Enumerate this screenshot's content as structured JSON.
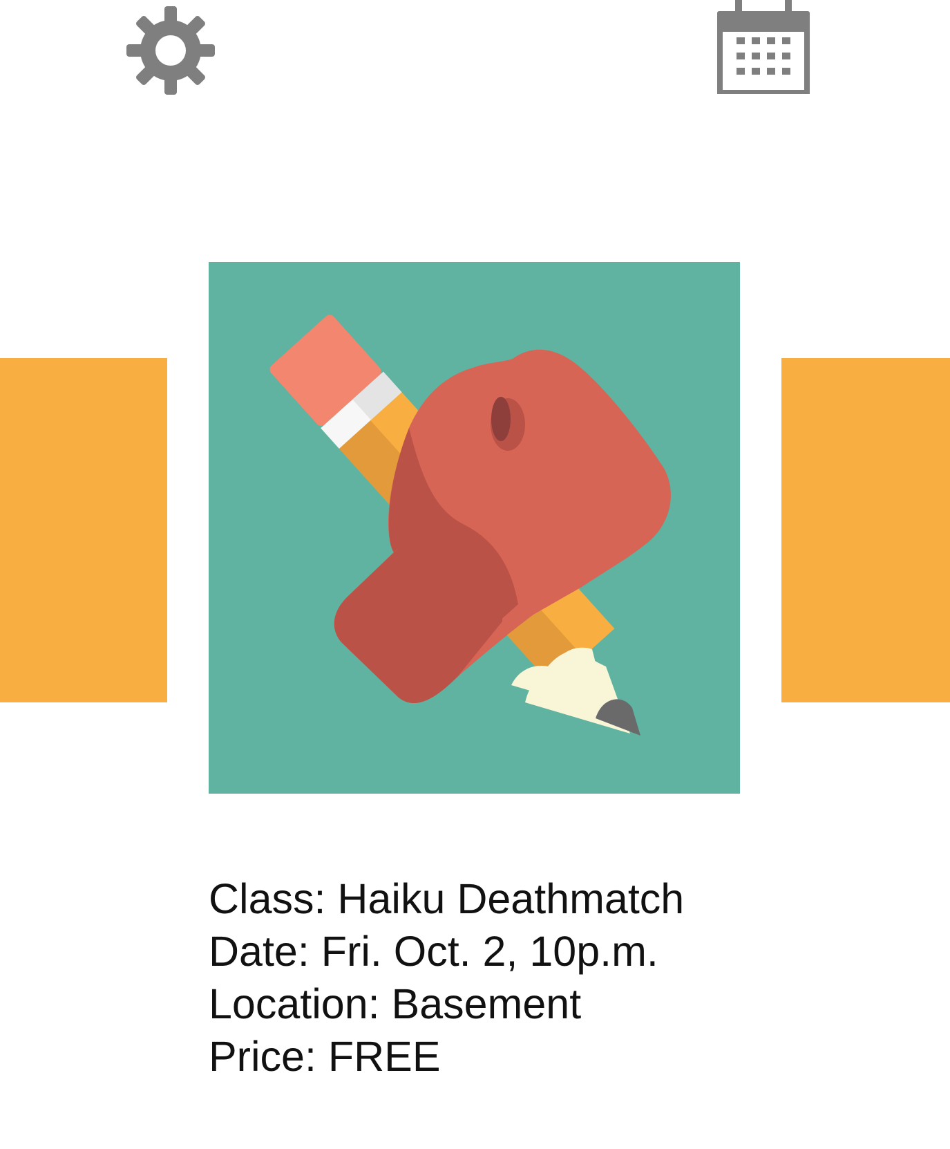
{
  "colors": {
    "background": "#ffffff",
    "icon_gray": "#7f7f7f",
    "panel_orange": "#F9AE41",
    "image_teal": "#5FB3A0",
    "glove_red": "#D66556",
    "glove_dark": "#BA5248",
    "pencil_eraser": "#F2866F",
    "pencil_body": "#F9AE41",
    "pencil_wood": "#F9F6D8",
    "pencil_tip": "#6A6A6A",
    "text": "#111111"
  },
  "toolbar": {
    "settings_icon": "gear-icon",
    "calendar_icon": "calendar-icon"
  },
  "event": {
    "image_icon": "boxing-glove-pencil-icon",
    "class_line": "Class: Haiku Deathmatch",
    "date_line": "Date: Fri. Oct. 2, 10p.m.",
    "location_line": "Location: Basement",
    "price_line": "Price: FREE"
  }
}
